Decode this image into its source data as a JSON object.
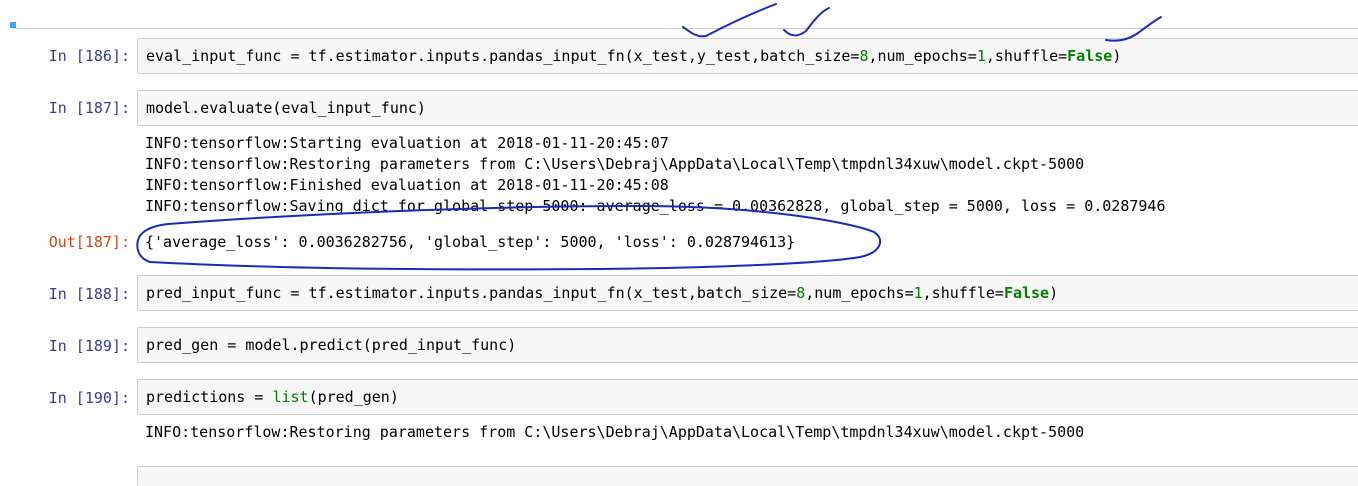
{
  "cells": [
    {
      "prompt": "In [186]:",
      "code": {
        "prefix": "eval_input_func = tf.estimator.inputs.pandas_input_fn(x_test,y_test,batch_size=",
        "n1": "8",
        "mid1": ",num_epochs=",
        "n2": "1",
        "mid2": ",shuffle=",
        "kw": "False",
        "suffix": ")"
      }
    },
    {
      "prompt": "In [187]:",
      "code_text": "model.evaluate(eval_input_func)",
      "log": [
        "INFO:tensorflow:Starting evaluation at 2018-01-11-20:45:07",
        "INFO:tensorflow:Restoring parameters from C:\\Users\\Debraj\\AppData\\Local\\Temp\\tmpdnl34xuw\\model.ckpt-5000",
        "INFO:tensorflow:Finished evaluation at 2018-01-11-20:45:08",
        "INFO:tensorflow:Saving dict for global step 5000: average_loss = 0.00362828, global_step = 5000, loss = 0.0287946"
      ],
      "out_prompt": "Out[187]:",
      "out_text": "{'average_loss': 0.0036282756, 'global_step': 5000, 'loss': 0.028794613}"
    },
    {
      "prompt": "In [188]:",
      "code": {
        "prefix": "pred_input_func = tf.estimator.inputs.pandas_input_fn(x_test,batch_size=",
        "n1": "8",
        "mid1": ",num_epochs=",
        "n2": "1",
        "mid2": ",shuffle=",
        "kw": "False",
        "suffix": ")"
      }
    },
    {
      "prompt": "In [189]:",
      "code_text": "pred_gen = model.predict(pred_input_func)"
    },
    {
      "prompt": "In [190]:",
      "code": {
        "prefix": "predictions = ",
        "builtin": "list",
        "suffix": "(pred_gen)"
      },
      "log": [
        "INFO:tensorflow:Restoring parameters from C:\\Users\\Debraj\\AppData\\Local\\Temp\\tmpdnl34xuw\\model.ckpt-5000"
      ]
    }
  ],
  "colors": {
    "in_prompt": "#303f9f",
    "out_prompt": "#d84315",
    "keyword": "#008000",
    "annotation_ink": "#1a2bb8",
    "cell_border": "#cfcfcf",
    "cell_bg": "#f7f7f7"
  }
}
